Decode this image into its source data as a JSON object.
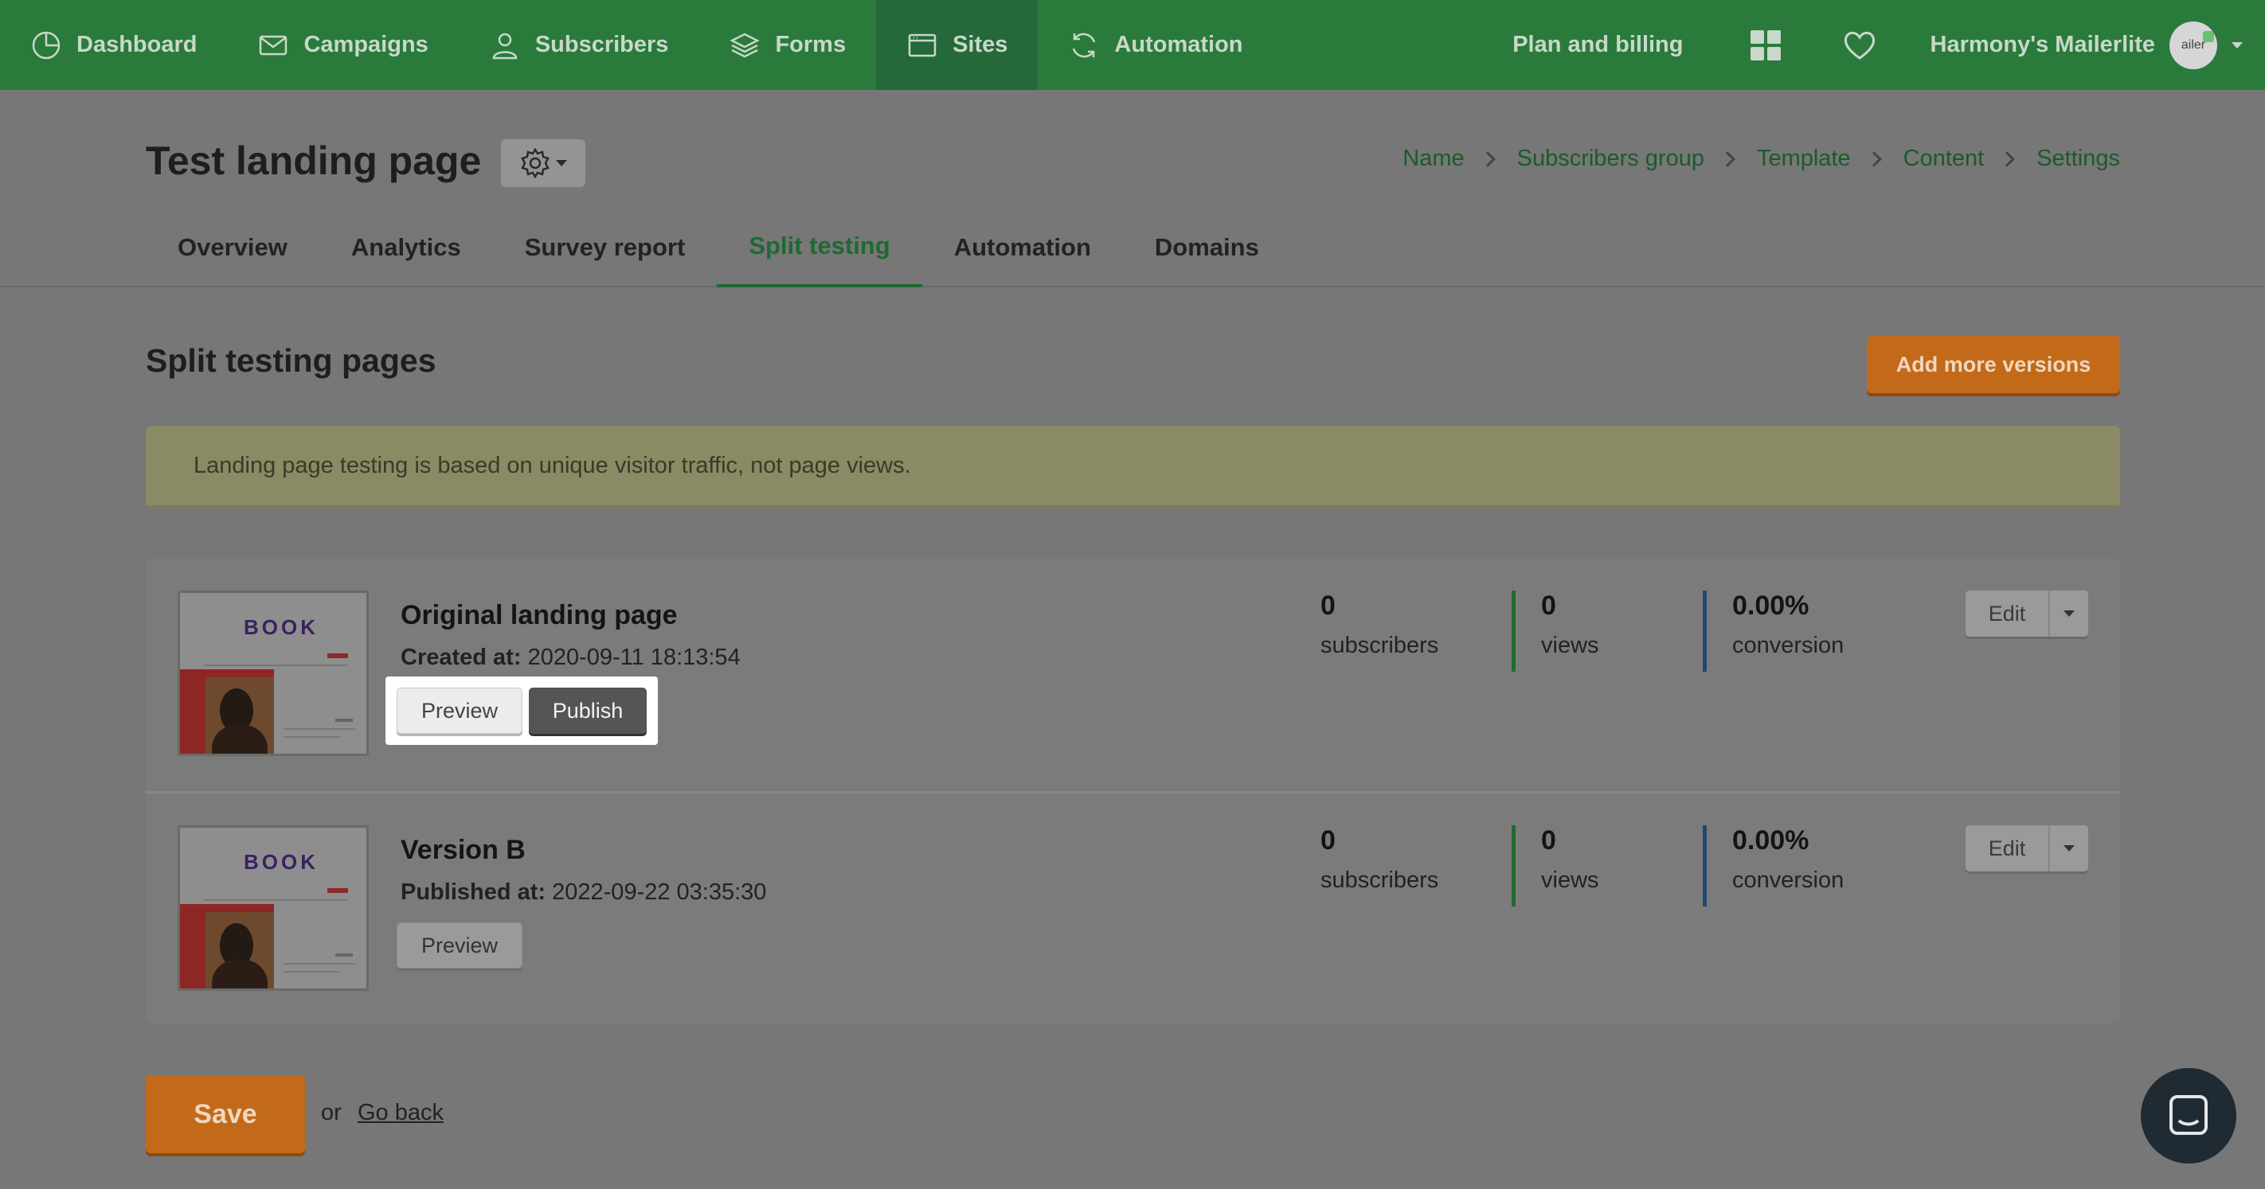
{
  "nav": {
    "items": [
      {
        "label": "Dashboard",
        "icon": "dashboard-icon"
      },
      {
        "label": "Campaigns",
        "icon": "envelope-icon"
      },
      {
        "label": "Subscribers",
        "icon": "user-icon"
      },
      {
        "label": "Forms",
        "icon": "layers-icon"
      },
      {
        "label": "Sites",
        "icon": "browser-icon"
      },
      {
        "label": "Automation",
        "icon": "refresh-icon"
      }
    ],
    "active": "Sites",
    "plan_billing": "Plan and billing",
    "account_name": "Harmony's Mailerlite",
    "avatar_text": "ailer"
  },
  "header": {
    "title": "Test landing page",
    "breadcrumb": [
      "Name",
      "Subscribers group",
      "Template",
      "Content",
      "Settings"
    ],
    "tabs": [
      "Overview",
      "Analytics",
      "Survey report",
      "Split testing",
      "Automation",
      "Domains"
    ],
    "active_tab": "Split testing"
  },
  "section": {
    "title": "Split testing pages",
    "add_button": "Add more versions",
    "notice": "Landing page testing is based on unique visitor traffic, not page views."
  },
  "pages": [
    {
      "thumb_logo": "BOOK",
      "title": "Original landing page",
      "meta_label": "Created at:",
      "meta_value": "2020-09-11 18:13:54",
      "preview_label": "Preview",
      "publish_label": "Publish",
      "subscribers_value": "0",
      "subscribers_label": "subscribers",
      "views_value": "0",
      "views_label": "views",
      "conversion_value": "0.00%",
      "conversion_label": "conversion",
      "edit_label": "Edit"
    },
    {
      "thumb_logo": "BOOK",
      "title": "Version B",
      "meta_label": "Published at:",
      "meta_value": "2022-09-22 03:35:30",
      "preview_label": "Preview",
      "subscribers_value": "0",
      "subscribers_label": "subscribers",
      "views_value": "0",
      "views_label": "views",
      "conversion_value": "0.00%",
      "conversion_label": "conversion",
      "edit_label": "Edit"
    }
  ],
  "footer": {
    "save_label": "Save",
    "or_text": "or",
    "go_back": "Go back"
  },
  "colors": {
    "nav_bg": "#2a7a3c",
    "accent_orange": "#c26a1a",
    "green_link": "#1d6a33",
    "views_bar": "#1f6b34",
    "conversion_bar": "#24486e"
  }
}
